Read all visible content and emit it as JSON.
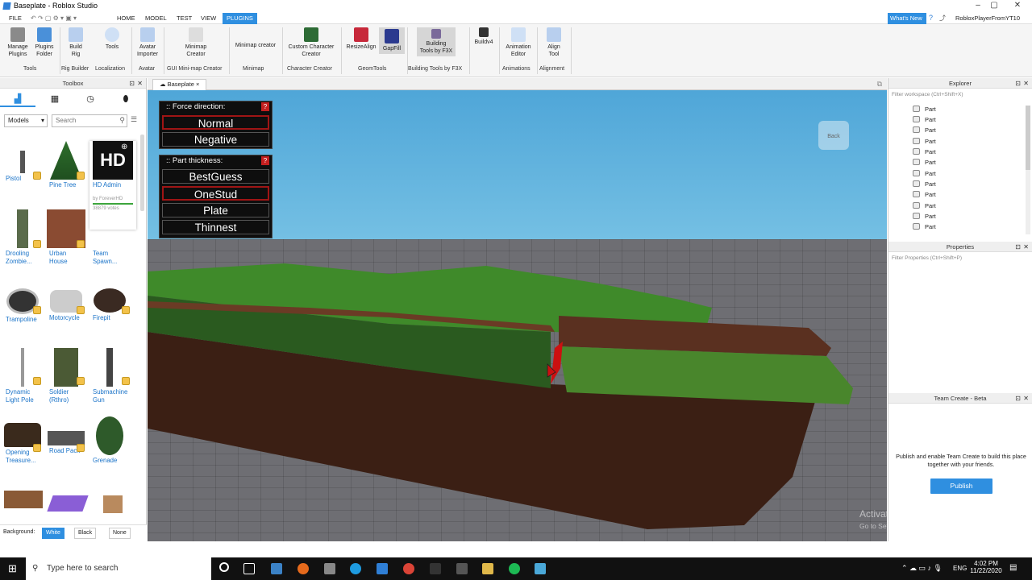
{
  "window": {
    "title": "Baseplate - Roblox Studio",
    "whats_new": "What's New",
    "user": "RobloxPlayerFromYT10",
    "min": "–",
    "max": "▢",
    "close": "✕"
  },
  "menu": {
    "file": "FILE",
    "home": "HOME",
    "model": "MODEL",
    "test": "TEST",
    "view": "VIEW",
    "plugins": "PLUGINS"
  },
  "ribbon": {
    "buttons": [
      "Manage\nPlugins",
      "Plugins\nFolder",
      "Build\nRig",
      "Tools",
      "Avatar\nImporter",
      "Minimap\nCreator",
      "Minimap creator",
      "Custom Character\nCreator",
      "ResizeAlign",
      "GapFill",
      "Building\nTools by F3X",
      "Buildv4",
      "Animation\nEditor",
      "Align\nTool"
    ],
    "groups": [
      "Tools",
      "Rig Builder",
      "Localization",
      "Avatar",
      "GUI Mini-map Creator",
      "Minimap",
      "Character Creator",
      "GeomTools",
      "Building Tools by F3X",
      "Animations",
      "Alignment"
    ]
  },
  "toolbox": {
    "title": "Toolbox",
    "category": "Models",
    "search_placeholder": "Search",
    "items": [
      "Pistol",
      "Pine Tree",
      "HD Admin",
      "Drooling\nZombie...",
      "Urban\nHouse",
      "Team\nSpawn...",
      "Trampoline",
      "Motorcycle",
      "Firepit",
      "Dynamic\nLight Pole",
      "Soldier\n(Rthro)",
      "Submachine\nGun",
      "Opening\nTreasure...",
      "Road Pack",
      "Grenade"
    ],
    "hd_creator": "by ForeverHD",
    "hd_votes": "38879 votes",
    "background_label": "Background:",
    "bg_white": "White",
    "bg_black": "Black",
    "bg_none": "None"
  },
  "viewport": {
    "tab": "Baseplate",
    "tab_close": "×",
    "cube_label": "Back",
    "force": {
      "title": "Force direction:",
      "options": [
        "Normal",
        "Negative"
      ],
      "selected": "Normal"
    },
    "thickness": {
      "title": "Part thickness:",
      "options": [
        "BestGuess",
        "OneStud",
        "Plate",
        "Thinnest"
      ],
      "selected": "OneStud"
    },
    "help": "?",
    "watermark1": "Activate Windows",
    "watermark2": "Go to Settings to activate Windows."
  },
  "explorer": {
    "title": "Explorer",
    "filter": "Filter workspace (Ctrl+Shift+X)",
    "items": [
      "Part",
      "Part",
      "Part",
      "Part",
      "Part",
      "Part",
      "Part",
      "Part",
      "Part",
      "Part",
      "Part",
      "Part"
    ]
  },
  "properties": {
    "title": "Properties",
    "filter": "Filter Properties (Ctrl+Shift+P)"
  },
  "team_create": {
    "title": "Team Create - Beta",
    "text": "Publish and enable Team Create to build this place together with your friends.",
    "button": "Publish"
  },
  "taskbar": {
    "search": "Type here to search",
    "lang": "ENG",
    "time": "4:02 PM",
    "date": "11/22/2020"
  }
}
